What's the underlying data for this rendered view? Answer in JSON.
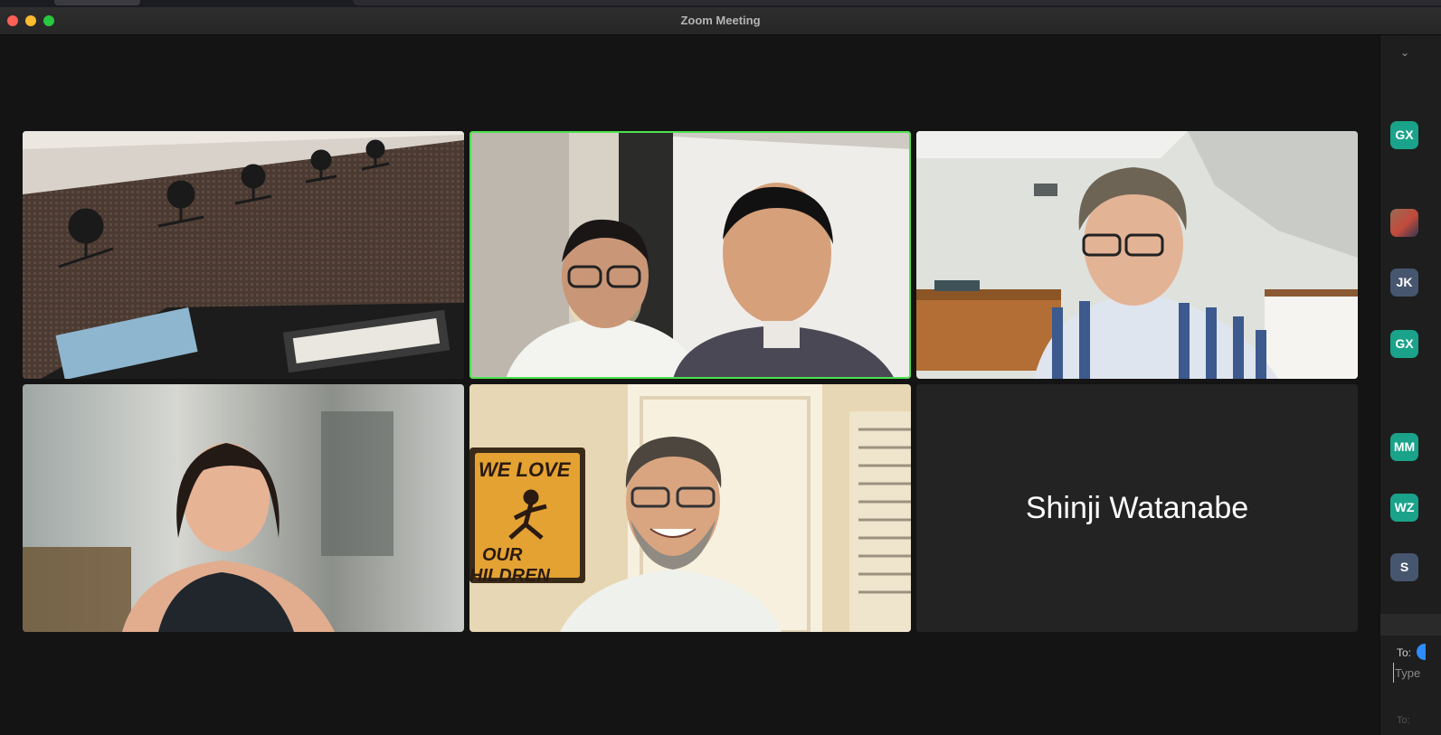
{
  "window": {
    "title": "Zoom Meeting"
  },
  "participants": [
    {
      "id": "room"
    },
    {
      "id": "two-people",
      "speaking": true
    },
    {
      "id": "man-striped-shirt"
    },
    {
      "id": "woman"
    },
    {
      "id": "man-glasses"
    },
    {
      "id": "video-off",
      "name": "Shinji Watanabe"
    }
  ],
  "sidebar": {
    "avatars": [
      {
        "initials": "GX",
        "color": "#1aa38a"
      },
      {
        "initials": "",
        "photo": true
      },
      {
        "initials": "JK",
        "color": "#46566e"
      },
      {
        "initials": "GX",
        "color": "#1aa38a"
      },
      {
        "initials": "MM",
        "color": "#1aa38a"
      },
      {
        "initials": "WZ",
        "color": "#1aa38a"
      },
      {
        "initials": "S",
        "color": "#46566e"
      }
    ],
    "chat": {
      "to_label": "To:",
      "placeholder": "Type",
      "to_label_2": "To:"
    }
  },
  "colors": {
    "active_speaker": "#4fe04f",
    "avatar_green": "#1aa38a",
    "avatar_slate": "#46566e"
  },
  "icons": [
    "chevron-down-icon"
  ]
}
